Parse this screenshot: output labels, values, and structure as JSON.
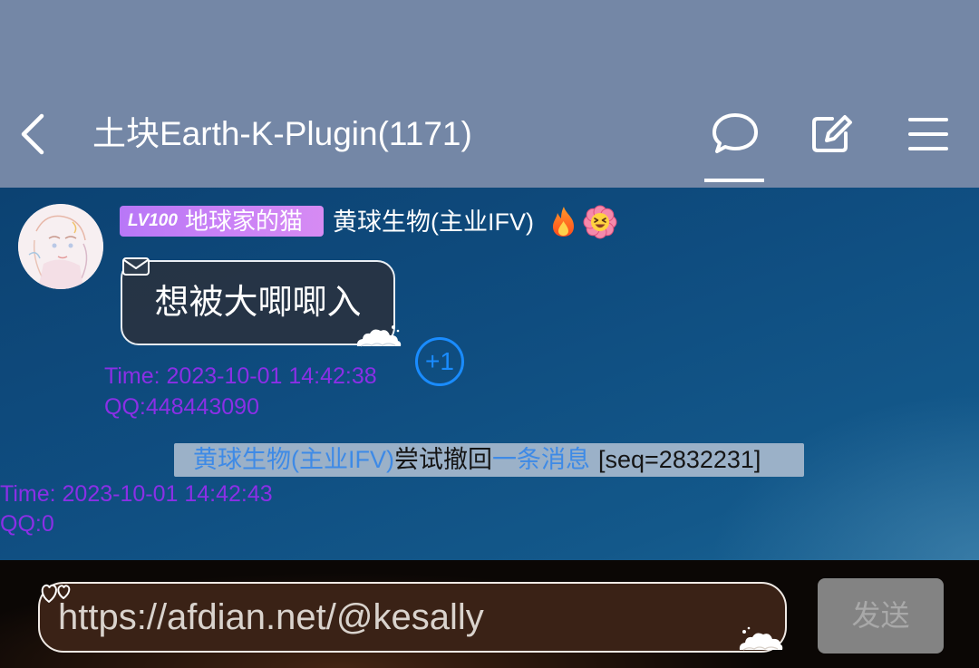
{
  "header": {
    "title": "土块Earth-K-Plugin(1171)",
    "icons": {
      "back": "chevron-left-icon",
      "chat": "chat-bubble-icon",
      "edit": "edit-icon",
      "menu": "menu-icon"
    },
    "active_tab": "chat"
  },
  "message": {
    "level": "LV100",
    "title_badge": "地球家的猫",
    "sender": "黄球生物(主业IFV)",
    "sender_icons": [
      "fire-icon",
      "flower-smile-icon"
    ],
    "text": "想被大唧唧入",
    "bubble_icons": [
      "envelope-icon",
      "cloud-icon"
    ],
    "plus_one": "+1",
    "time": "Time: 2023-10-01 14:42:38",
    "qq": "QQ:448443090"
  },
  "recall_notice": {
    "name": "黄球生物(主业IFV)",
    "action": "尝试撤回",
    "target": "一条消息",
    "seq": "[seq=2832231]",
    "time": "Time: 2023-10-01 14:42:43",
    "qq": "QQ:0"
  },
  "composer": {
    "input_value": "https://afdian.net/@kesally",
    "send_label": "发送",
    "decor_icons": [
      "hearts-icon",
      "cloud-icon"
    ]
  },
  "colors": {
    "header_bg": "#7487a6",
    "chat_bg": "#0f4d80",
    "meta_text": "#8b2fe6",
    "notice_bg": "#9bb1c8",
    "notice_link": "#3e8ae6",
    "plus_one": "#1a8cff",
    "badge": "#c981f6",
    "input_bg": "#3a2216",
    "send_button": "#838383"
  }
}
